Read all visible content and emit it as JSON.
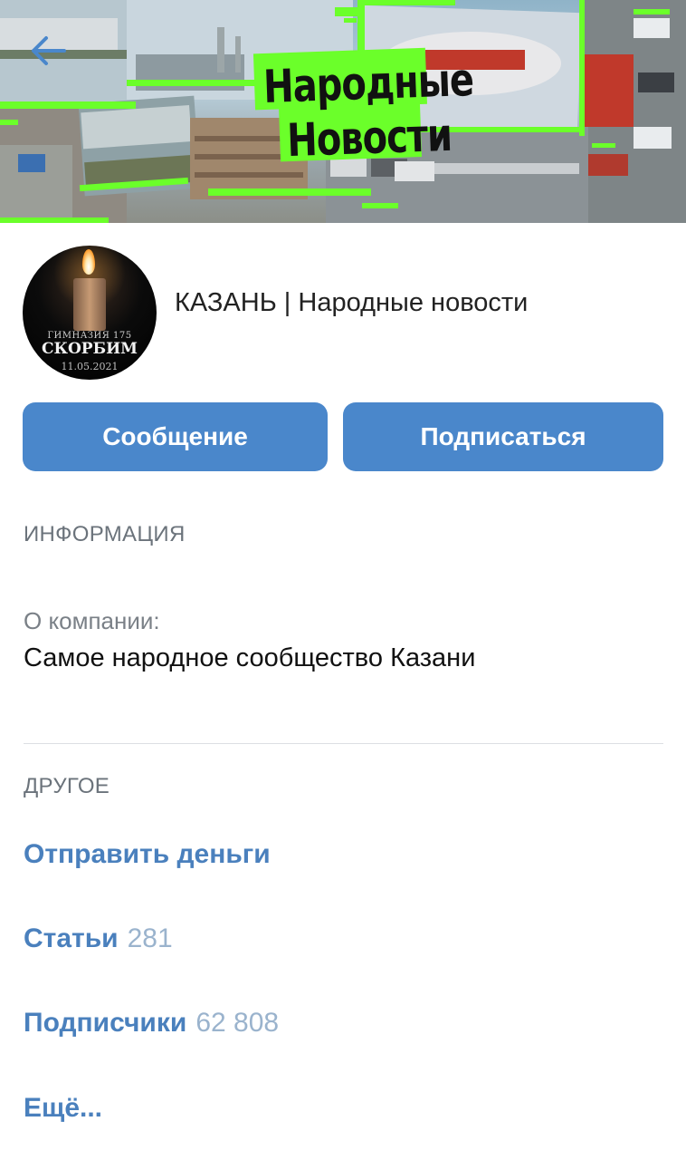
{
  "cover": {
    "title_line1": "Народные",
    "title_line2": "Новости",
    "accent_color": "#6bff2a"
  },
  "back_button": {
    "icon": "arrow-left-icon"
  },
  "avatar": {
    "line1": "ГИМНАЗИЯ 175",
    "line2": "СКОРБИМ",
    "line3": "11.05.2021"
  },
  "group": {
    "name": "КАЗАНЬ | Народные новости"
  },
  "actions": {
    "message_label": "Сообщение",
    "subscribe_label": "Подписаться",
    "button_color": "#4a87cb"
  },
  "info": {
    "title": "ИНФОРМАЦИЯ",
    "about_label": "О компании:",
    "about_value": "Самое народное сообщество Казани"
  },
  "other": {
    "title": "ДРУГОЕ",
    "send_money": "Отправить деньги",
    "articles_label": "Статьи",
    "articles_count": "281",
    "subscribers_label": "Подписчики",
    "subscribers_count": "62 808",
    "more_label": "Ещё...",
    "link_color": "#4a80bd"
  }
}
